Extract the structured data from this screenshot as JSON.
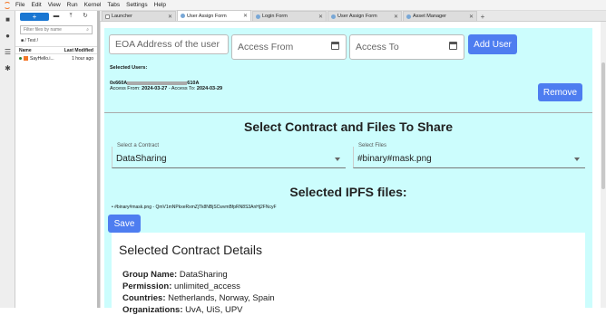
{
  "menu": [
    "File",
    "Edit",
    "View",
    "Run",
    "Kernel",
    "Tabs",
    "Settings",
    "Help"
  ],
  "filebrowser": {
    "new_label": "+",
    "filter_placeholder": "Filter files by name",
    "breadcrumb": "■ / Test /",
    "col_name": "Name",
    "col_modified": "Last Modified",
    "files": [
      {
        "name": "SayHello.i...",
        "modified": "1 hour ago"
      }
    ]
  },
  "tabs": [
    {
      "label": "Launcher",
      "active": false
    },
    {
      "label": "User Assign Form",
      "active": true
    },
    {
      "label": "Login Form",
      "active": false
    },
    {
      "label": "User Assign Form",
      "active": false
    },
    {
      "label": "Asset Manager",
      "active": false
    }
  ],
  "form": {
    "eoa_placeholder": "EOA Address of the user",
    "access_from_placeholder": "Access From",
    "access_to_placeholder": "Access To",
    "add_user_label": "Add User",
    "selected_users_label": "Selected Users:",
    "user_address_start": "0x660A",
    "user_address_end": "610A",
    "access_from_label": "Access From:",
    "access_from_value": "2024-03-27",
    "access_to_label": "Access To:",
    "access_to_value": "2024-03-29",
    "remove_label": "Remove"
  },
  "select_section": {
    "title": "Select Contract and Files To Share",
    "contract_label": "Select a Contract",
    "contract_value": "DataSharing",
    "files_label": "Select Files",
    "files_value": "#binary#mask.png"
  },
  "ipfs": {
    "title": "Selected IPFS files:",
    "file_entry": "#binary#mask.png - QmV1mNPkxeRxmZjTk8NBjSCwvmBfpRN8S3AnHj2FNcyF",
    "save_label": "Save"
  },
  "contract_details": {
    "title": "Selected Contract Details",
    "group_name_label": "Group Name:",
    "group_name_value": "DataSharing",
    "permission_label": "Permission:",
    "permission_value": "unlimited_access",
    "countries_label": "Countries:",
    "countries_value": "Netherlands, Norway, Spain",
    "organizations_label": "Organizations:",
    "organizations_value": "UvA, UiS, UPV"
  }
}
